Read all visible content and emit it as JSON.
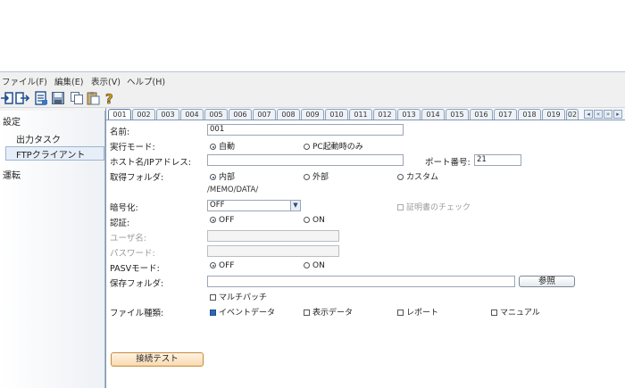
{
  "menu": [
    "ファイル(F)",
    "編集(E)",
    "表示(V)",
    "ヘルプ(H)"
  ],
  "toolbar_icons": [
    "import-icon",
    "export-icon",
    "properties-icon",
    "save-icon",
    "copy-icon",
    "paste-icon",
    "help-icon"
  ],
  "sidebar": {
    "settings": "設定",
    "items": [
      "出力タスク",
      "FTPクライアント"
    ],
    "selected": "FTPクライアント",
    "operation": "運転"
  },
  "tabs": [
    "001",
    "002",
    "003",
    "004",
    "005",
    "006",
    "007",
    "008",
    "009",
    "010",
    "011",
    "012",
    "013",
    "014",
    "015",
    "016",
    "017",
    "018",
    "019",
    "02"
  ],
  "active_tab": "001",
  "tab_nav": [
    "◂",
    "«",
    "»",
    "▸"
  ],
  "form": {
    "name_label": "名前:",
    "name_value": "001",
    "run_mode_label": "実行モード:",
    "run_mode_options": [
      "自動",
      "PC起動時のみ"
    ],
    "run_mode_selected": "自動",
    "host_label": "ホスト名/IPアドレス:",
    "host_value": "",
    "port_label": "ポート番号:",
    "port_value": "21",
    "folder_label": "取得フォルダ:",
    "folder_options": [
      "内部",
      "外部",
      "カスタム"
    ],
    "folder_selected": "内部",
    "folder_path": "/MEMO/DATA/",
    "encrypt_label": "暗号化:",
    "encrypt_value": "OFF",
    "cert_check_label": "証明書のチェック",
    "auth_label": "認証:",
    "auth_options": [
      "OFF",
      "ON"
    ],
    "auth_selected": "OFF",
    "user_label": "ユーザ名:",
    "user_value": "",
    "password_label": "パスワード:",
    "password_value": "",
    "pasv_label": "PASVモード:",
    "pasv_options": [
      "OFF",
      "ON"
    ],
    "pasv_selected": "OFF",
    "save_folder_label": "保存フォルダ:",
    "save_folder_value": "",
    "browse_button": "参照",
    "multi_patch_label": "マルチパッチ",
    "file_type_label": "ファイル種類:",
    "file_type_options": [
      "イベントデータ",
      "表示データ",
      "レポート",
      "マニュアル"
    ],
    "file_type_checked": [
      "イベントデータ"
    ],
    "connect_test_button": "接続テスト"
  }
}
